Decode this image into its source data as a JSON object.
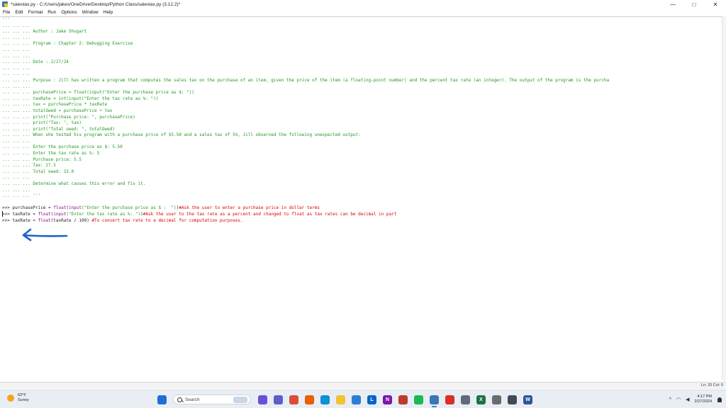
{
  "window": {
    "title": "*salestax.py - C:/Users/jakes/OneDrive/Desktop/Python Class/salestax.py (3.12.2)*",
    "controls": {
      "minimize": "—",
      "maximize": "□",
      "close": "✕"
    }
  },
  "menu": [
    "File",
    "Edit",
    "Format",
    "Run",
    "Options",
    "Window",
    "Help"
  ],
  "editor": {
    "lines": [
      {
        "kind": "code",
        "text": "'''"
      },
      {
        "kind": "code",
        "text": "... ... ..."
      },
      {
        "kind": "code",
        "text": "... ... ... Author : Jake Shugart"
      },
      {
        "kind": "code",
        "text": "... ... ..."
      },
      {
        "kind": "code",
        "text": "... ... ... Program : Chapter 2: Debugging Exercise"
      },
      {
        "kind": "code",
        "text": "... ... ..."
      },
      {
        "kind": "code",
        "text": "... ... ..."
      },
      {
        "kind": "code",
        "text": "... ... ... Date : 2/27/24"
      },
      {
        "kind": "code",
        "text": "... ... ..."
      },
      {
        "kind": "code",
        "text": "... ... ..."
      },
      {
        "kind": "code",
        "text": "... ... ... Purpose : Jill has written a program that computes the sales tax on the purchase of an item, given the price of the item (a floating-point number) and the percent tax rate (an integer). The output of the program is the purcha"
      },
      {
        "kind": "code",
        "text": "... ... ..."
      },
      {
        "kind": "code",
        "text": "... ... ... purchasePrice = float(input(\"Enter the purchase price as $: \"))"
      },
      {
        "kind": "code",
        "text": "... ... ... taxRate = int(input(\"Enter the tax rate as %: \"))"
      },
      {
        "kind": "code",
        "text": "... ... ... tax = purchasePrice * taxRate"
      },
      {
        "kind": "code",
        "text": "... ... ... totalOwed = purchasePrice + tax"
      },
      {
        "kind": "code",
        "text": "... ... ... print(\"Purchase price: \", purchasePrice)"
      },
      {
        "kind": "code",
        "text": "... ... ... print(\"Tax: \", tax)"
      },
      {
        "kind": "code",
        "text": "... ... ... print(\"Total owed: \", totalOwed)"
      },
      {
        "kind": "code",
        "text": "... ... ... When she tested his program with a purchase price of $5.50 and a sales tax of 5%, Jill observed the following unexpected output:"
      },
      {
        "kind": "code",
        "text": "... ... ..."
      },
      {
        "kind": "code",
        "text": "... ... ... Enter the purchase price as $: 5.50"
      },
      {
        "kind": "code",
        "text": "... ... ... Enter the tax rate as %: 5"
      },
      {
        "kind": "code",
        "text": "... ... ... Purchase price: 5.5"
      },
      {
        "kind": "code",
        "text": "... ... ... Tax: 27.5"
      },
      {
        "kind": "code",
        "text": "... ... ... Total owed: 33.0"
      },
      {
        "kind": "code",
        "text": "... ... ..."
      },
      {
        "kind": "code",
        "text": "... ... ... Determine what causes this error and fix it."
      },
      {
        "kind": "code",
        "text": "... ... ..."
      },
      {
        "kind": "code",
        "text": "... ... ... '''"
      },
      {
        "kind": "code",
        "text": ""
      }
    ],
    "prompt_lines": [
      {
        "prompt": ">>> ",
        "var": "purchasePrice = ",
        "func1": "float",
        "p1": "(",
        "func2": "input",
        "str": "(\"Enter the purchase price as $ :  \")",
        "close": ")",
        "comment": "#Ask the user to enter a purchase price in dollar terms"
      },
      {
        "prompt": ">>> ",
        "var": "taxRate = ",
        "func1": "float",
        "p1": "(",
        "func2": "input",
        "str": "(\"Enter the tax rate as %: \")",
        "close": ")",
        "comment": "#Ask the user to the tax rate as a percent and changed to float as tax rates can be decimal in part"
      },
      {
        "prompt": ">>> ",
        "var": "taxRate = ",
        "func1": "float",
        "p1": "(taxRate / 100) ",
        "func2": "",
        "str": "",
        "close": "",
        "comment": "#To convert tax rate to a decimal for computation purposes."
      }
    ]
  },
  "status": {
    "position": "Ln: 33   Col: 0"
  },
  "taskbar": {
    "weather": {
      "temp": "63°F",
      "condition": "Sunny"
    },
    "search_label": "Search",
    "icons": [
      {
        "name": "start-icon",
        "label": "",
        "color": "#1f6fd6"
      },
      {
        "name": "search",
        "label": "",
        "color": ""
      },
      {
        "name": "copilot-icon",
        "label": "",
        "color": "#6a4fd8"
      },
      {
        "name": "teams-icon",
        "label": "",
        "color": "#5b5fc7"
      },
      {
        "name": "chrome-icon",
        "label": "",
        "color": "#dd4b39"
      },
      {
        "name": "firefox-icon",
        "label": "",
        "color": "#e66000"
      },
      {
        "name": "edge-icon",
        "label": "",
        "color": "#0f8fd6"
      },
      {
        "name": "file-explorer-icon",
        "label": "",
        "color": "#f2c230"
      },
      {
        "name": "store-icon",
        "label": "",
        "color": "#2d7fd3"
      },
      {
        "name": "linkedin-icon",
        "label": "L",
        "color": "#0a66c2"
      },
      {
        "name": "onenote-icon",
        "label": "N",
        "color": "#7719aa"
      },
      {
        "name": "gallery-icon",
        "label": "",
        "color": "#c0392b"
      },
      {
        "name": "spotify-icon",
        "label": "",
        "color": "#1db954"
      },
      {
        "name": "python-idle-icon",
        "label": "",
        "color": "#3b77b4"
      },
      {
        "name": "todo-icon",
        "label": "",
        "color": "#d93025"
      },
      {
        "name": "settings-icon",
        "label": "",
        "color": "#5f6b7a"
      },
      {
        "name": "excel-icon",
        "label": "X",
        "color": "#1d7044"
      },
      {
        "name": "snipping-icon",
        "label": "",
        "color": "#6b6b6b"
      },
      {
        "name": "calculator-icon",
        "label": "",
        "color": "#444a55"
      },
      {
        "name": "word-icon",
        "label": "W",
        "color": "#2b5797"
      }
    ],
    "tray": {
      "chevron": "^",
      "network": "◠",
      "volume": "◀",
      "time": "4:17 PM",
      "date": "2/27/2024"
    }
  },
  "annotation": {
    "arrow_color": "#1e63c6"
  }
}
